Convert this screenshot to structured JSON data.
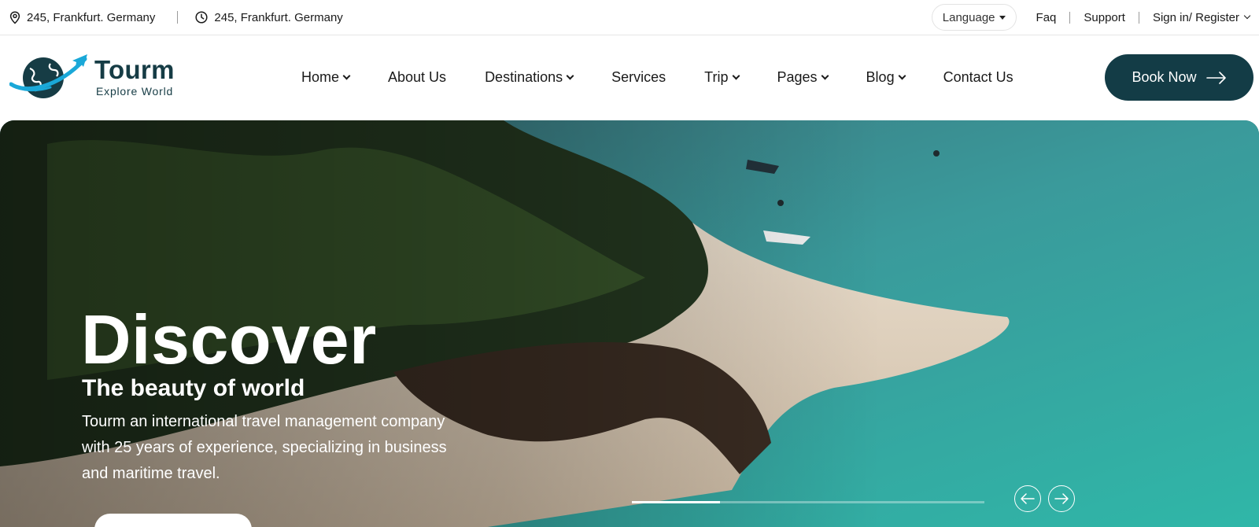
{
  "topbar": {
    "address_1": "245, Frankfurt. Germany",
    "address_2": "245, Frankfurt. Germany",
    "language_label": "Language",
    "faq": "Faq",
    "support": "Support",
    "signin": "Sign in/ Register"
  },
  "logo": {
    "name": "Tourm",
    "tagline": "Explore World",
    "icon": "globe-plane-icon",
    "color": "#163c45",
    "accent": "#1aa8d8"
  },
  "nav": {
    "items": [
      {
        "label": "Home",
        "dropdown": true
      },
      {
        "label": "About Us",
        "dropdown": false
      },
      {
        "label": "Destinations",
        "dropdown": true
      },
      {
        "label": "Services",
        "dropdown": false
      },
      {
        "label": "Trip",
        "dropdown": true
      },
      {
        "label": "Pages",
        "dropdown": true
      },
      {
        "label": "Blog",
        "dropdown": true
      },
      {
        "label": "Contact Us",
        "dropdown": false
      }
    ],
    "book_label": "Book Now",
    "book_color": "#133c46"
  },
  "hero": {
    "title": "Discover",
    "subtitle": "The beauty of world",
    "description": "Tourm an international travel management company with 25 years of experience, specializing in business and maritime travel.",
    "slider_progress": 0.25,
    "prev_icon": "arrow-left-icon",
    "next_icon": "arrow-right-icon"
  }
}
